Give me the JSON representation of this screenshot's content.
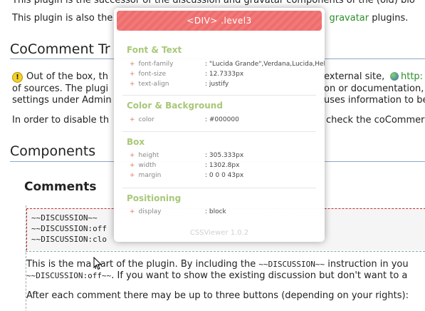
{
  "page": {
    "intro_line1": "This plugin is the successor of the discussion and gravatar components of the (old) blo",
    "intro_line2_pre": "This plugin is also the",
    "intro_line2_link": "gravatar",
    "intro_line2_post": "plugins.",
    "heading_cocomment": "CoComment Tr",
    "para1_line1_pre": "Out of the box, th",
    "para1_line1_post": "external site,",
    "para1_line1_link": "http:",
    "para1_line2_pre": "of sources. The plugi",
    "para1_line2_post": "on or documentation,",
    "para1_line3_pre": "settings under Admin",
    "para1_line3_post": "uses information to be",
    "para2_pre": "In order to disable th",
    "para2_post": "check the coCommer",
    "heading_components": "Components",
    "heading_comments": "Comments",
    "code_lines": [
      "~~DISCUSSION~~",
      "~~DISCUSSION:off",
      "~~DISCUSSION:clo"
    ],
    "para3_line1_pre": "This is the ma",
    "para3_line1_mid": "part of the plugin. By including the",
    "para3_line1_code": "~~DISCUSSION~~",
    "para3_line1_post": "instruction in you",
    "para3_line2_code": "~~DISCUSSION:off~~",
    "para3_line2_post": ". If you want to show the existing discussion but don't want to a",
    "para4": "After each comment there may be up to three buttons (depending on your rights):"
  },
  "viewer": {
    "title": "<DIV> .level3",
    "sections": {
      "font": {
        "title": "Font & Text",
        "props": [
          {
            "name": "font-family",
            "value": ": \"Lucida Grande\",Verdana,Lucida,Helvetica,Arial,sans-serif"
          },
          {
            "name": "font-size",
            "value": ": 12.7333px"
          },
          {
            "name": "text-align",
            "value": ": justify"
          }
        ]
      },
      "color": {
        "title": "Color & Background",
        "props": [
          {
            "name": "color",
            "value": ": #000000"
          }
        ]
      },
      "box": {
        "title": "Box",
        "props": [
          {
            "name": "height",
            "value": ": 305.333px"
          },
          {
            "name": "width",
            "value": ": 1302.8px"
          },
          {
            "name": "margin",
            "value": ": 0 0 0 43px"
          }
        ]
      },
      "positioning": {
        "title": "Positioning",
        "props": [
          {
            "name": "display",
            "value": ": block"
          }
        ]
      }
    },
    "footer": "CSSViewer 1.0.2",
    "plus": "+"
  },
  "icons": {
    "warning": "warning-icon",
    "globe": "globe-icon",
    "cursor": "mouse-cursor-icon"
  },
  "colors": {
    "link": "#2a8f2a",
    "viewer_title_bg": "#ef6d6d",
    "section_title": "#a8c878",
    "code_border": "#c43030"
  }
}
